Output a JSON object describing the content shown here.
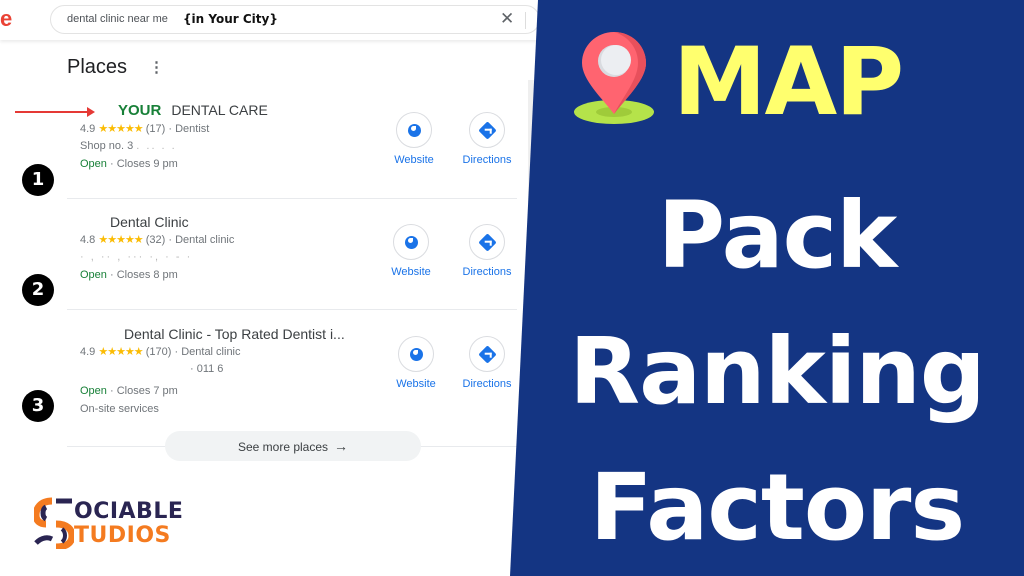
{
  "search": {
    "logo_fragment": "e",
    "query": "dental clinic near me",
    "query_suffix": "{in Your City}",
    "clear_icon": "close-icon"
  },
  "places": {
    "title": "Places",
    "menu_icon": "more-vert-icon",
    "listings": [
      {
        "rank": "1",
        "name_highlight": "YOUR",
        "name": "DENTAL CARE",
        "rating": "4.9",
        "stars": "★★★★★",
        "reviews": "(17)",
        "category": "· Dentist",
        "address": "Shop no. 3",
        "address_blurred": ". ..   .  .",
        "status": "Open",
        "hours": "· Closes 9 pm",
        "extra": "",
        "website_label": "Website",
        "directions_label": "Directions"
      },
      {
        "rank": "2",
        "name_highlight": "",
        "name": "Dental Clinic",
        "rating": "4.8",
        "stars": "★★★★★",
        "reviews": "(32)",
        "category": "· Dental clinic",
        "address": "",
        "address_blurred": "· , ·· , ··· ·,         · - ·",
        "status": "Open",
        "hours": "· Closes 8 pm",
        "extra": "",
        "website_label": "Website",
        "directions_label": "Directions"
      },
      {
        "rank": "3",
        "name_highlight": "",
        "name": "Dental Clinic - Top Rated Dentist i...",
        "rating": "4.9",
        "stars": "★★★★★",
        "reviews": "(170)",
        "category": "· Dental clinic",
        "address": "· 011 6",
        "address_blurred": "",
        "status": "Open",
        "hours": "· Closes 7 pm",
        "extra": "On-site services",
        "website_label": "Website",
        "directions_label": "Directions"
      }
    ],
    "see_more_label": "See more places",
    "see_more_arrow": "→"
  },
  "branding": {
    "row1": "OCIABLE",
    "row2": "TUDIOS",
    "colors": {
      "navy": "#2a2552",
      "orange": "#f47b20"
    }
  },
  "headline": {
    "word1": "MAP",
    "word2": "Pack",
    "word3": "Ranking",
    "word4": "Factors",
    "icon": "map-pin-icon",
    "colors": {
      "panel": "#143583",
      "accent": "#ffff6e",
      "text": "#ffffff"
    }
  }
}
